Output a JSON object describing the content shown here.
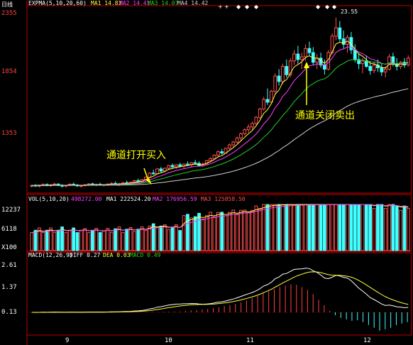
{
  "colors": {
    "background": "#000000",
    "frame": "#c00000",
    "up_candle": "#ff5050",
    "down_candle": "#40ffff",
    "ma5": "#ffff40",
    "ma10": "#ff40ff",
    "ma20": "#20d020",
    "ma60": "#d0d0d0",
    "annotation": "#ffff00",
    "vol_ma": "#ffff40",
    "macd_diff": "#ffffff",
    "macd_dea": "#ffff40",
    "macd_bar_pos": "#ff4040",
    "macd_bar_neg": "#40ffff"
  },
  "price_panel": {
    "period_label": "日线",
    "indicator_label": "EXPMA(5,10,20,60)",
    "ma_labels": [
      "MA1 14.83",
      "MA2 14.41",
      "MA3 14.07",
      "MA4 14.42"
    ],
    "y_ticks": [
      "2355",
      "1854",
      "1353"
    ],
    "high_label": "23.55",
    "annotation_open": "通道打开买入",
    "annotation_close": "通道关闭卖出",
    "markers": [
      "+",
      "+",
      "◆",
      "◆",
      "◆",
      "◆",
      "◆",
      "◆"
    ]
  },
  "volume_panel": {
    "header": "VOL(5,10,20)",
    "values": [
      "498272.00",
      "MA1 222524.20",
      "MA2 176956.59",
      "MA3 125858.50"
    ],
    "y_ticks": [
      "12237",
      "6118",
      "X100"
    ]
  },
  "macd_panel": {
    "header": "MACD(12,26,9)",
    "diff": "DIFF 0.27",
    "dea": "DEA 0.03",
    "macd": "MACD 0.49",
    "y_ticks": [
      "2.61",
      "1.37",
      "0.13"
    ]
  },
  "x_axis": {
    "labels": [
      "9",
      "10",
      "11",
      "12"
    ]
  },
  "chart_data": {
    "type": "candlestick",
    "candles": [
      [
        11.3,
        11.4,
        11.2,
        11.35
      ],
      [
        11.35,
        11.45,
        11.25,
        11.3
      ],
      [
        11.3,
        11.4,
        11.2,
        11.38
      ],
      [
        11.38,
        11.5,
        11.3,
        11.42
      ],
      [
        11.42,
        11.5,
        11.3,
        11.33
      ],
      [
        11.33,
        11.45,
        11.25,
        11.4
      ],
      [
        11.4,
        11.55,
        11.35,
        11.45
      ],
      [
        11.45,
        11.5,
        11.3,
        11.35
      ],
      [
        11.35,
        11.45,
        11.2,
        11.3
      ],
      [
        11.3,
        11.4,
        11.2,
        11.36
      ],
      [
        11.36,
        11.5,
        11.3,
        11.44
      ],
      [
        11.44,
        11.55,
        11.35,
        11.38
      ],
      [
        11.38,
        11.45,
        11.25,
        11.32
      ],
      [
        11.32,
        11.4,
        11.2,
        11.34
      ],
      [
        11.34,
        11.45,
        11.28,
        11.4
      ],
      [
        11.4,
        11.52,
        11.32,
        11.46
      ],
      [
        11.46,
        11.55,
        11.35,
        11.39
      ],
      [
        11.39,
        11.48,
        11.3,
        11.43
      ],
      [
        11.43,
        11.55,
        11.35,
        11.37
      ],
      [
        11.37,
        11.45,
        11.28,
        11.41
      ],
      [
        11.41,
        11.5,
        11.32,
        11.45
      ],
      [
        11.45,
        11.6,
        11.4,
        11.5
      ],
      [
        11.5,
        11.65,
        11.38,
        11.42
      ],
      [
        11.42,
        11.55,
        11.3,
        11.48
      ],
      [
        11.48,
        11.6,
        11.4,
        11.55
      ],
      [
        11.55,
        11.7,
        11.45,
        11.5
      ],
      [
        11.5,
        11.62,
        11.4,
        11.58
      ],
      [
        11.58,
        11.75,
        11.5,
        11.7
      ],
      [
        11.7,
        11.85,
        11.6,
        11.65
      ],
      [
        11.65,
        11.8,
        11.55,
        11.78
      ],
      [
        11.78,
        12.0,
        11.7,
        11.95
      ],
      [
        11.95,
        12.3,
        11.9,
        12.25
      ],
      [
        12.25,
        12.5,
        12.1,
        12.2
      ],
      [
        12.2,
        12.6,
        12.15,
        12.55
      ],
      [
        12.55,
        12.7,
        12.3,
        12.4
      ],
      [
        12.4,
        12.65,
        12.3,
        12.6
      ],
      [
        12.6,
        12.85,
        12.5,
        12.8
      ],
      [
        12.8,
        12.95,
        12.6,
        12.7
      ],
      [
        12.7,
        12.9,
        12.55,
        12.85
      ],
      [
        12.85,
        13.0,
        12.7,
        12.75
      ],
      [
        12.75,
        12.95,
        12.6,
        12.9
      ],
      [
        12.9,
        13.1,
        12.8,
        12.85
      ],
      [
        12.85,
        13.05,
        12.7,
        13.0
      ],
      [
        13.0,
        13.2,
        12.9,
        12.95
      ],
      [
        12.95,
        13.1,
        12.75,
        12.8
      ],
      [
        12.8,
        13.0,
        12.7,
        12.9
      ],
      [
        12.9,
        13.2,
        12.85,
        13.15
      ],
      [
        13.15,
        13.4,
        13.0,
        13.3
      ],
      [
        13.3,
        13.6,
        13.2,
        13.55
      ],
      [
        13.55,
        13.9,
        13.4,
        13.8
      ],
      [
        13.8,
        14.0,
        13.6,
        13.7
      ],
      [
        13.7,
        14.1,
        13.65,
        14.05
      ],
      [
        14.05,
        14.4,
        13.9,
        14.3
      ],
      [
        14.3,
        14.6,
        14.1,
        14.5
      ],
      [
        14.5,
        14.9,
        14.4,
        14.8
      ],
      [
        14.8,
        15.2,
        14.6,
        15.1
      ],
      [
        15.1,
        15.5,
        15.0,
        15.4
      ],
      [
        15.4,
        15.8,
        15.2,
        15.6
      ],
      [
        15.6,
        16.0,
        15.4,
        15.85
      ],
      [
        15.85,
        16.4,
        15.7,
        16.3
      ],
      [
        16.3,
        17.0,
        16.2,
        16.9
      ],
      [
        16.9,
        17.8,
        16.8,
        17.6
      ],
      [
        17.6,
        18.4,
        17.2,
        17.4
      ],
      [
        17.4,
        18.3,
        17.3,
        18.2
      ],
      [
        18.2,
        19.5,
        18.0,
        19.3
      ],
      [
        19.3,
        19.8,
        18.6,
        18.9
      ],
      [
        18.9,
        20.2,
        18.7,
        20.0
      ],
      [
        20.0,
        20.5,
        19.2,
        19.4
      ],
      [
        19.4,
        20.6,
        19.2,
        20.4
      ],
      [
        20.4,
        21.2,
        20.1,
        20.9
      ],
      [
        20.9,
        21.5,
        20.2,
        20.5
      ],
      [
        20.5,
        21.0,
        19.8,
        20.7
      ],
      [
        20.7,
        21.6,
        20.4,
        21.3
      ],
      [
        21.3,
        21.8,
        20.8,
        21.0
      ],
      [
        21.0,
        21.4,
        20.1,
        20.3
      ],
      [
        20.3,
        20.9,
        19.8,
        20.6
      ],
      [
        20.6,
        21.0,
        19.9,
        20.1
      ],
      [
        20.1,
        20.5,
        19.4,
        19.8
      ],
      [
        19.8,
        21.2,
        19.7,
        21.0
      ],
      [
        21.0,
        22.4,
        20.9,
        22.2
      ],
      [
        22.2,
        23.55,
        21.9,
        22.8
      ],
      [
        22.8,
        23.3,
        21.8,
        22.0
      ],
      [
        22.0,
        22.6,
        21.3,
        21.6
      ],
      [
        21.6,
        22.3,
        21.0,
        22.1
      ],
      [
        22.1,
        22.5,
        20.9,
        21.2
      ],
      [
        21.2,
        21.6,
        20.3,
        20.5
      ],
      [
        20.5,
        20.9,
        19.8,
        20.2
      ],
      [
        20.2,
        20.6,
        19.5,
        20.4
      ],
      [
        20.4,
        20.8,
        19.9,
        20.0
      ],
      [
        20.0,
        20.4,
        19.4,
        19.7
      ],
      [
        19.7,
        20.3,
        19.5,
        20.1
      ],
      [
        20.1,
        20.5,
        19.6,
        19.9
      ],
      [
        19.9,
        20.2,
        19.3,
        19.6
      ],
      [
        19.6,
        20.0,
        19.2,
        19.8
      ],
      [
        19.8,
        20.9,
        19.7,
        20.7
      ],
      [
        20.7,
        21.0,
        20.0,
        20.2
      ],
      [
        20.2,
        20.6,
        19.7,
        20.0
      ],
      [
        20.0,
        20.4,
        19.8,
        20.3
      ],
      [
        20.3,
        20.6,
        19.9,
        20.1
      ],
      [
        20.1,
        20.8,
        20.0,
        20.6
      ]
    ],
    "macd_hist": [
      0.01,
      0.01,
      0.02,
      0.01,
      0.02,
      0.02,
      0.03,
      0.03,
      0.05,
      0.07,
      0.08,
      0.1,
      0.12,
      0.15,
      0.18,
      0.22,
      0.26,
      0.3,
      0.35,
      0.42,
      0.5,
      0.58,
      0.68,
      0.75,
      0.82,
      0.9,
      0.95,
      1.0,
      0.98,
      0.9,
      0.8,
      0.65,
      0.45,
      0.25,
      0.05,
      -0.1,
      -0.2,
      -0.25,
      -0.3,
      -0.28,
      -0.35,
      -0.45,
      -0.55,
      -0.65,
      -0.6,
      -0.55,
      -0.45,
      -0.4,
      -0.35
    ]
  }
}
